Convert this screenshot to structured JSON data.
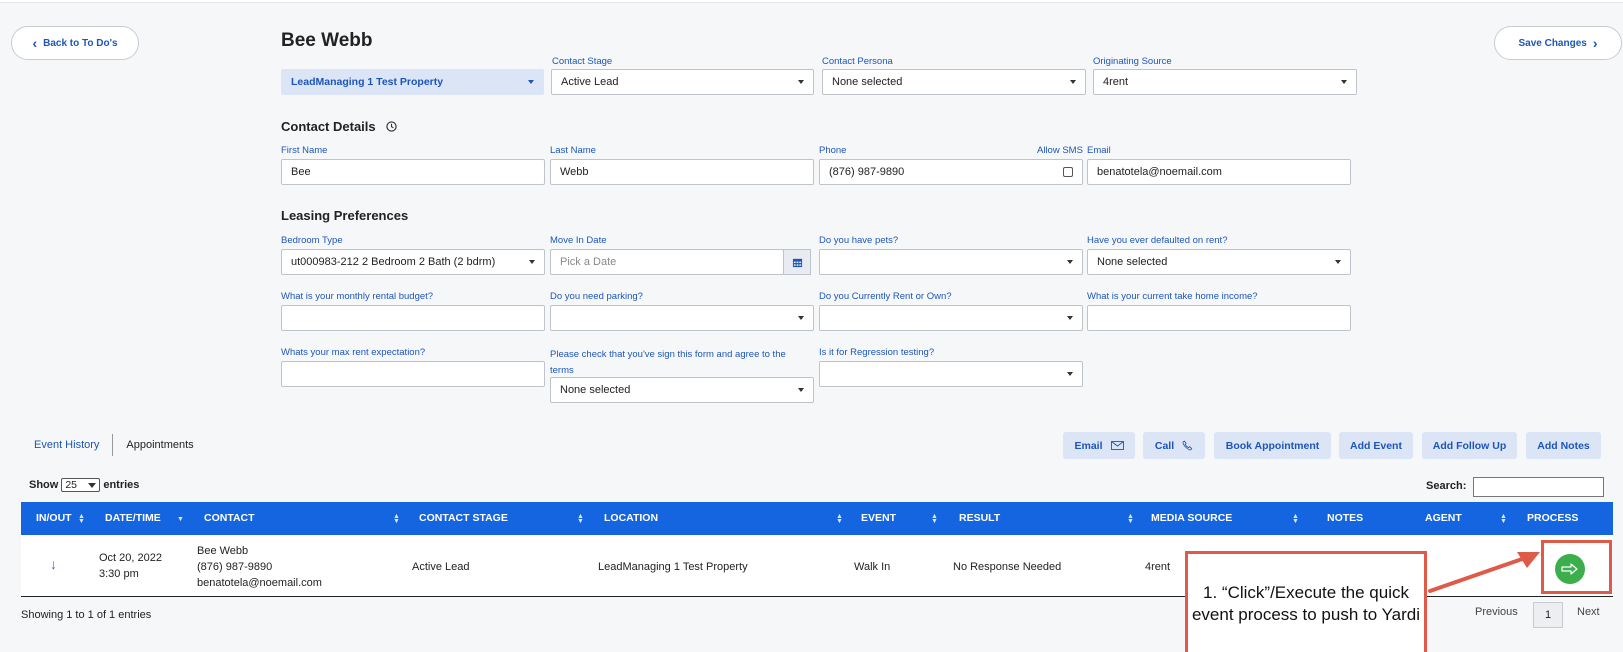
{
  "nav": {
    "back_label": "Back to To Do's",
    "save_label": "Save Changes"
  },
  "contact": {
    "name": "Bee Webb",
    "property": "LeadManaging 1 Test Property",
    "stage_label": "Contact Stage",
    "stage_value": "Active Lead",
    "persona_label": "Contact Persona",
    "persona_value": "None selected",
    "source_label": "Originating Source",
    "source_value": "4rent"
  },
  "details": {
    "section_title": "Contact Details",
    "first_name_label": "First Name",
    "first_name": "Bee",
    "last_name_label": "Last Name",
    "last_name": "Webb",
    "phone_label": "Phone",
    "phone": "(876) 987-9890",
    "allow_sms_label": "Allow SMS",
    "email_label": "Email",
    "email": "benatotela@noemail.com"
  },
  "leasing": {
    "section_title": "Leasing Preferences",
    "bedroom_label": "Bedroom Type",
    "bedroom_value": "ut000983-212 2 Bedroom 2 Bath (2 bdrm)",
    "move_in_label": "Move In Date",
    "move_in_placeholder": "Pick a Date",
    "pets_label": "Do you have pets?",
    "pets_value": "",
    "defaulted_label": "Have you ever defaulted on rent?",
    "defaulted_value": "None selected",
    "budget_label": "What is your monthly rental budget?",
    "budget_value": "",
    "parking_label": "Do you need parking?",
    "parking_value": "",
    "rent_own_label": "Do you Currently Rent or Own?",
    "rent_own_value": "",
    "income_label": "What is your current take home income?",
    "income_value": "",
    "max_rent_label": "Whats your max rent expectation?",
    "max_rent_value": "",
    "terms_label": "Please check that you've sign this form and agree to the terms",
    "terms_value": "None selected",
    "regression_label": "Is it for Regression testing?",
    "regression_value": ""
  },
  "tabs": {
    "event_history": "Event History",
    "appointments": "Appointments"
  },
  "actions": {
    "email": "Email",
    "call": "Call",
    "book": "Book Appointment",
    "add_event": "Add Event",
    "add_follow_up": "Add Follow Up",
    "add_notes": "Add Notes"
  },
  "table": {
    "show_label": "Show",
    "entries_value": "25",
    "entries_label": "entries",
    "search_label": "Search:",
    "headers": [
      "IN/OUT",
      "DATE/TIME",
      "CONTACT",
      "CONTACT STAGE",
      "LOCATION",
      "EVENT",
      "RESULT",
      "MEDIA SOURCE",
      "NOTES",
      "AGENT",
      "PROCESS"
    ],
    "rows": [
      {
        "direction": "↓",
        "date": "Oct 20, 2022",
        "time": "3:30 pm",
        "contact_name": "Bee Webb",
        "contact_phone": "(876) 987-9890",
        "contact_email": "benatotela@noemail.com",
        "stage": "Active Lead",
        "location": "LeadManaging 1 Test Property",
        "event": "Walk In",
        "result": "No Response Needed",
        "media_source": "4rent",
        "notes": "",
        "agent": ""
      }
    ],
    "footer": "Showing 1 to 1 of 1 entries",
    "previous": "Previous",
    "page": "1",
    "next": "Next"
  },
  "annotation": {
    "line1": "1. “Click”/Execute the quick",
    "line2": "event process to push to Yardi",
    "color": "#e05a4a"
  },
  "colors": {
    "accent": "#1d56b8",
    "table_header": "#1565e0",
    "process_green": "#3cae4c"
  }
}
